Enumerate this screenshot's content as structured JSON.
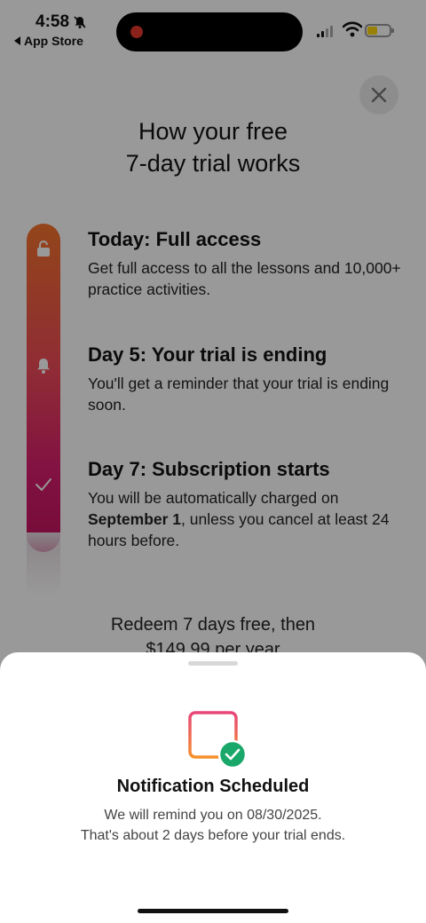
{
  "status_bar": {
    "time": "4:58",
    "back_label": "App Store"
  },
  "page": {
    "title_line1": "How your free",
    "title_line2": "7-day trial works",
    "steps": [
      {
        "heading": "Today: Full access",
        "body": "Get full access to all the lessons and 10,000+ practice activities.",
        "icon": "lock-open-icon"
      },
      {
        "heading": "Day 5: Your trial is ending",
        "body": "You'll get a reminder that your trial is ending soon.",
        "icon": "bell-icon"
      },
      {
        "heading": "Day 7: Subscription starts",
        "body_before": "You will be automatically charged on",
        "body_bold": "September 1",
        "body_after": ", unless you cancel at least 24 hours before.",
        "icon": "check-icon"
      }
    ],
    "redeem_line1": "Redeem 7 days free, then",
    "redeem_line2": "$149.99 per year"
  },
  "sheet": {
    "title": "Notification Scheduled",
    "message_line1": "We will remind you on 08/30/2025.",
    "message_line2": "That's about 2 days before your trial ends."
  },
  "colors": {
    "accent_orange": "#f5742c",
    "accent_pink": "#d81e6f",
    "success_green": "#1aa86a"
  }
}
